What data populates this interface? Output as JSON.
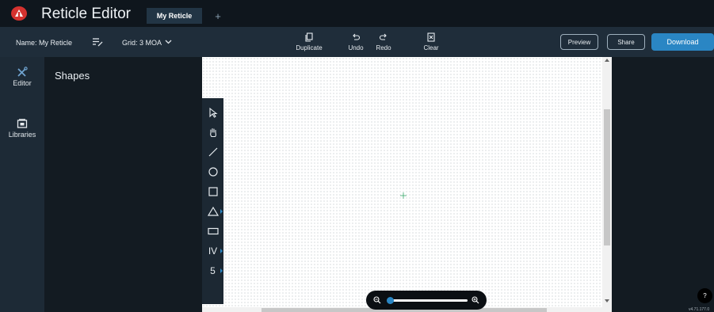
{
  "app": {
    "title": "Reticle Editor",
    "tabs": [
      {
        "label": "My Reticle",
        "active": true
      }
    ],
    "add_tab_label": "+",
    "logo_icon": "atn-logo"
  },
  "toolbar": {
    "name_label": "Name: My Reticle",
    "grid_label": "Grid: 3 MOA",
    "actions": {
      "duplicate": "Duplicate",
      "undo": "Undo",
      "redo": "Redo",
      "clear": "Clear"
    },
    "preview": "Preview",
    "share": "Share",
    "download": "Download"
  },
  "sidebar": {
    "items": [
      {
        "label": "Editor",
        "icon": "tools-icon"
      },
      {
        "label": "Libraries",
        "icon": "library-icon"
      }
    ]
  },
  "panel": {
    "title": "Shapes"
  },
  "tools": {
    "items": [
      "select-arrow-icon",
      "pan-hand-icon",
      "line-icon",
      "circle-icon",
      "square-icon",
      "triangle-icon",
      "rectangle-icon",
      "roman-numeral-tool",
      "number-tool"
    ],
    "roman_label": "IV",
    "number_label": "5"
  },
  "zoom": {
    "level_fraction": 0.02
  },
  "help": {
    "label": "?"
  },
  "version": "v4.71.177.0",
  "colors": {
    "accent": "#2a86c4",
    "titlebar": "#0f161d",
    "toolbar": "#1f2d3a",
    "rail": "#1d2a36",
    "canvas": "#ffffff",
    "crosshair": "#3aa86b"
  }
}
